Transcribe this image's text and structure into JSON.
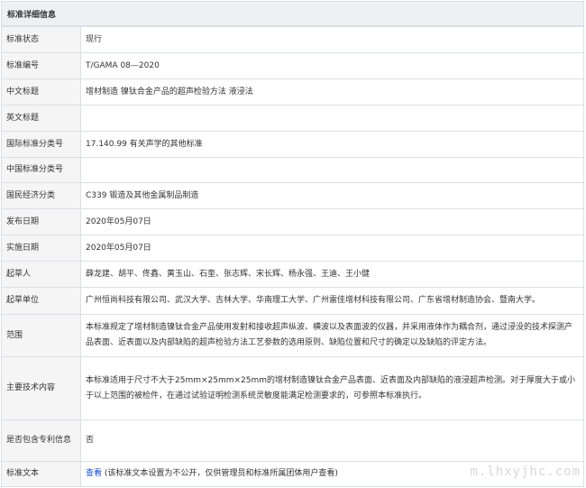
{
  "header": {
    "title": "标准详细信息"
  },
  "rows": [
    {
      "label": "标准状态",
      "value": "现行"
    },
    {
      "label": "标准编号",
      "value": "T/GAMA 08—2020"
    },
    {
      "label": "中文标题",
      "value": "增材制造 镍钛合金产品的超声检验方法 液浸法"
    },
    {
      "label": "英文标题",
      "value": ""
    },
    {
      "label": "国际标准分类号",
      "value": "17.140.99 有关声学的其他标准"
    },
    {
      "label": "中国标准分类号",
      "value": ""
    },
    {
      "label": "国民经济分类",
      "value": "C339 锻造及其他金属制品制造"
    },
    {
      "label": "发布日期",
      "value": "2020年05月07日"
    },
    {
      "label": "实施日期",
      "value": "2020年05月07日"
    },
    {
      "label": "起草人",
      "value": "薛龙建、胡平、佟鑫、黄玉山、石奎、张志辉、宋长辉、杨永强、王迪、王小健"
    },
    {
      "label": "起草单位",
      "value": "广州恒尚科技有限公司、武汉大学、吉林大学、华南理工大学、广州雷佳增材科技有限公司、广东省增材制造协会、暨南大学。"
    },
    {
      "label": "范围",
      "value": "本标准规定了增材制造镍钛合金产品使用发射和接收超声纵波、横波以及表面波的仪器，并采用液体作为耦合剂，通过浸没的技术探测产品表面、近表面以及内部缺陷的超声检验方法工艺参数的选用原则、缺陷位置和尺寸的确定以及缺陷的评定方法。"
    },
    {
      "label": "主要技术内容",
      "value": "本标准适用于尺寸不大于25mm×25mm×25mm的增材制造镍钛合金产品表面、近表面及内部缺陷的液浸超声检测。对于厚度大于或小于以上范围的被检件，在通过试验证明检测系统灵敏度能满足检测要求的，可参照本标准执行。"
    },
    {
      "label": "是否包含专利信息",
      "value": "否"
    },
    {
      "label": "标准文本",
      "link": "查看",
      "value": "(该标准文本设置为不公开，仅供管理员和标准所属团体用户查看)"
    }
  ],
  "watermark": "m.lhxyjhc.com"
}
